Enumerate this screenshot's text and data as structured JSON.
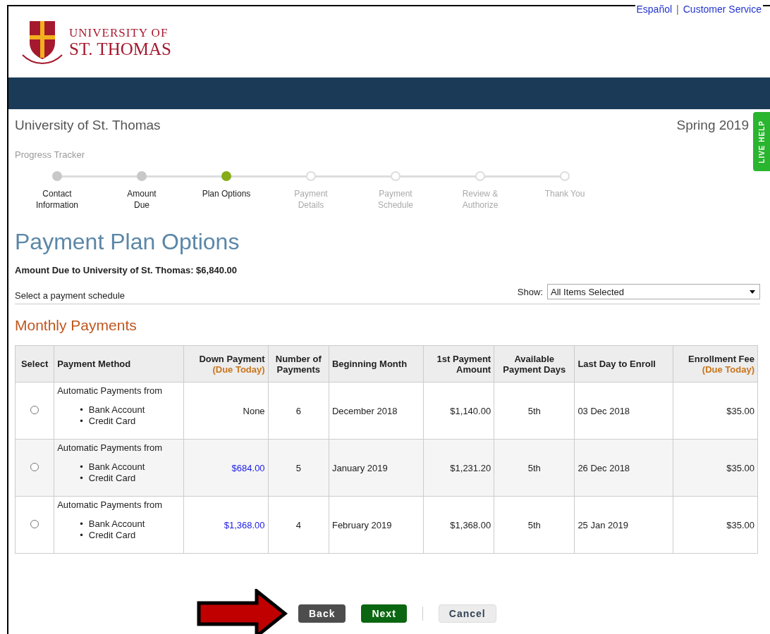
{
  "top_links": [
    "Español",
    "Customer Service"
  ],
  "top_separator": "|",
  "logo": {
    "line1": "UNIVERSITY OF",
    "line2": "ST. THOMAS"
  },
  "school": "University of St. Thomas",
  "term": "Spring 2019",
  "live_help": "LIVE HELP",
  "tracker": {
    "label": "Progress Tracker",
    "steps": [
      {
        "lines": [
          "Contact",
          "Information"
        ],
        "completed": true,
        "selected": false
      },
      {
        "lines": [
          "Amount",
          "Due"
        ],
        "completed": true,
        "selected": false
      },
      {
        "lines": [
          "Plan Options"
        ],
        "completed": false,
        "selected": true
      },
      {
        "lines": [
          "Payment",
          "Details"
        ],
        "completed": false,
        "selected": false
      },
      {
        "lines": [
          "Payment",
          "Schedule"
        ],
        "completed": false,
        "selected": false
      },
      {
        "lines": [
          "Review &",
          "Authorize"
        ],
        "completed": false,
        "selected": false
      },
      {
        "lines": [
          "Thank You"
        ],
        "completed": false,
        "selected": false
      }
    ]
  },
  "heading": "Payment Plan Options",
  "amount_due": "Amount Due to University of St. Thomas: $6,840.00",
  "select_prompt": "Select a payment schedule",
  "show": {
    "label": "Show:",
    "value": "All Items Selected"
  },
  "section": "Monthly Payments",
  "table": {
    "columns": [
      {
        "lines": [
          "Select"
        ]
      },
      {
        "lines": [
          "Payment Method"
        ]
      },
      {
        "lines": [
          "Down Payment"
        ],
        "note": "(Due Today)"
      },
      {
        "lines": [
          "Number of",
          "Payments"
        ]
      },
      {
        "lines": [
          "Beginning Month"
        ]
      },
      {
        "lines": [
          "1st Payment",
          "Amount"
        ]
      },
      {
        "lines": [
          "Available",
          "Payment Days"
        ]
      },
      {
        "lines": [
          "Last Day to Enroll"
        ]
      },
      {
        "lines": [
          "Enrollment Fee"
        ],
        "note": "(Due Today)"
      }
    ],
    "rows": [
      {
        "selected": false,
        "method": "Automatic Payments from",
        "options": [
          {
            "bullet": "•",
            "label": "Bank Account"
          },
          {
            "bullet": "•",
            "label": "Credit Card"
          }
        ],
        "down_payment": "None",
        "down_is_link": false,
        "count": "6",
        "begin": "December 2018",
        "first": "$1,140.00",
        "days": "5th",
        "last_day": "03 Dec 2018",
        "fee": "$35.00"
      },
      {
        "selected": false,
        "method": "Automatic Payments from",
        "options": [
          {
            "bullet": "•",
            "label": "Bank Account"
          },
          {
            "bullet": "•",
            "label": "Credit Card"
          }
        ],
        "down_payment": "$684.00",
        "down_is_link": true,
        "count": "5",
        "begin": "January 2019",
        "first": "$1,231.20",
        "days": "5th",
        "last_day": "26 Dec 2018",
        "fee": "$35.00"
      },
      {
        "selected": false,
        "method": "Automatic Payments from",
        "options": [
          {
            "bullet": "•",
            "label": "Bank Account"
          },
          {
            "bullet": "•",
            "label": "Credit Card"
          }
        ],
        "down_payment": "$1,368.00",
        "down_is_link": true,
        "count": "4",
        "begin": "February 2019",
        "first": "$1,368.00",
        "days": "5th",
        "last_day": "25 Jan 2019",
        "fee": "$35.00"
      }
    ]
  },
  "buttons": [
    {
      "label": "Back",
      "kind": "dark"
    },
    {
      "label": "Next",
      "kind": "primary"
    },
    {
      "label": "Cancel",
      "kind": "light"
    }
  ]
}
